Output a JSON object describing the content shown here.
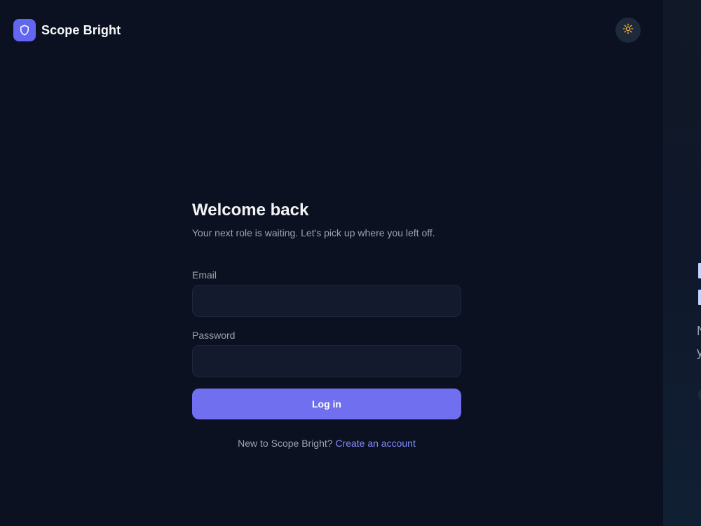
{
  "brand": {
    "name": "Scope Bright",
    "icon": "shield-icon",
    "accent": "#6366f1"
  },
  "header": {
    "theme_toggle_icon": "sun-icon"
  },
  "login": {
    "title": "Welcome back",
    "subtitle": "Your next role is waiting. Let's pick up where you left off.",
    "email_label": "Email",
    "email_value": "",
    "password_label": "Password",
    "password_value": "",
    "submit_label": "Log in",
    "signup_prompt": "New to Scope Bright?",
    "signup_link": "Create an account"
  },
  "side_panel": {
    "text_line_1": "N",
    "text_line_2": "y"
  },
  "colors": {
    "background": "#0b1120",
    "button": "#6f6ff0",
    "link": "#818cf8",
    "sun": "#f5b83d"
  }
}
